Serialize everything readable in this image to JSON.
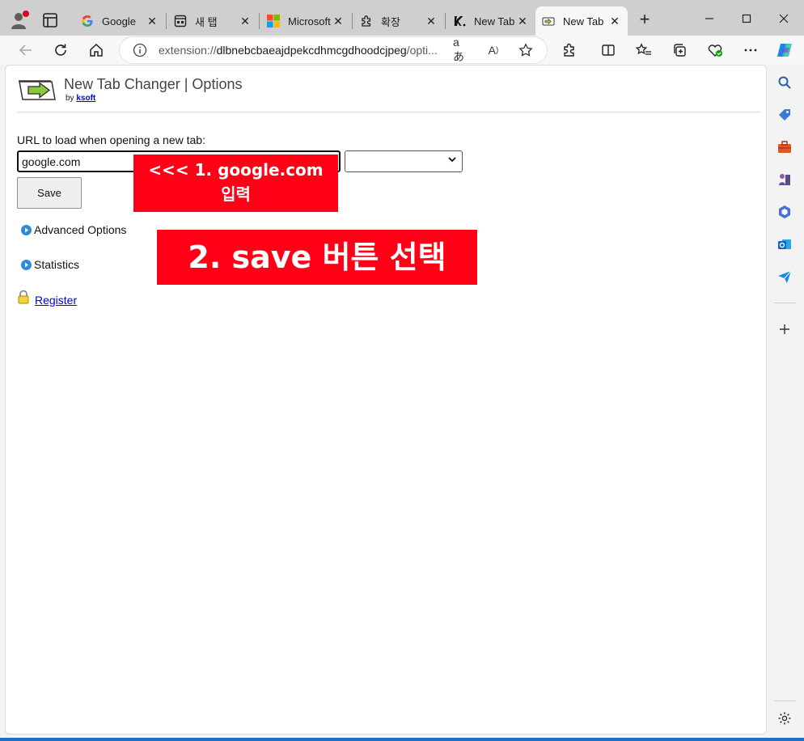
{
  "tabs": [
    {
      "title": "Google",
      "icon": "google-icon"
    },
    {
      "title": "새 탭",
      "icon": "newtab-icon"
    },
    {
      "title": "Microsoft",
      "icon": "microsoft-icon"
    },
    {
      "title": "확장",
      "icon": "puzzle-icon"
    },
    {
      "title": "New Tab",
      "icon": "k-icon"
    },
    {
      "title": "New Tab",
      "icon": "arrow-icon",
      "active": true
    }
  ],
  "address": {
    "prefix": "extension://",
    "host": "dlbnebcbaeajdpekcdhmcgdhoodcjpeg",
    "path": "/opti..."
  },
  "page": {
    "title": "New Tab Changer | Options",
    "by_label": "by",
    "author": "ksoft",
    "url_label": "URL to load when opening a new tab:",
    "url_value": "google.com",
    "save_label": "Save",
    "advanced_label": "Advanced Options",
    "statistics_label": "Statistics",
    "register_label": "Register"
  },
  "annotations": {
    "step1_line1": "<<< 1. google.com",
    "step1_line2": "입력",
    "step2": "2. save 버튼 선택"
  },
  "colors": {
    "annotation": "#ff0016",
    "link": "#0000ee",
    "taskbar": "#1c6fc4"
  }
}
